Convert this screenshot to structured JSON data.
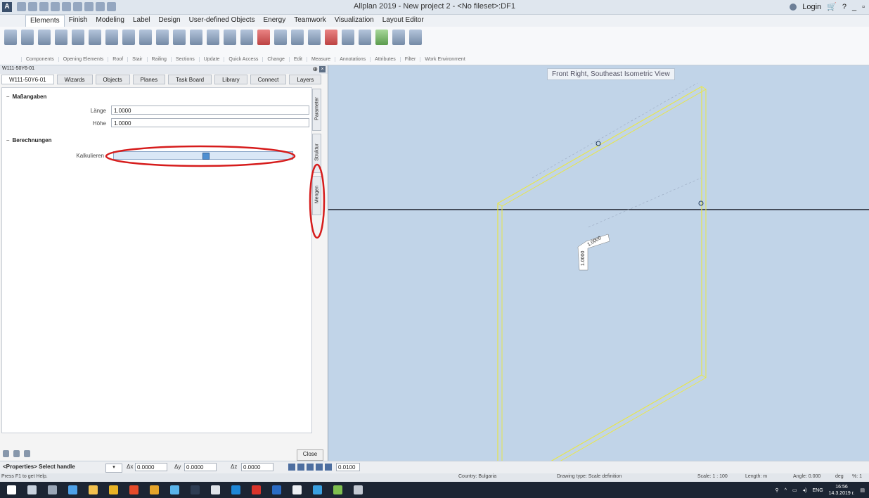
{
  "titlebar": {
    "title": "Allplan 2019 - New project 2 - <No fileset>:DF1",
    "login": "Login"
  },
  "menu_tabs": [
    "Elements",
    "Finish",
    "Modeling",
    "Label",
    "Design",
    "User-defined Objects",
    "Energy",
    "Teamwork",
    "Visualization",
    "Layout Editor"
  ],
  "ribbon_groups": [
    "Components",
    "Opening Elements",
    "Roof",
    "Stair",
    "Railing",
    "Sections",
    "Update",
    "Quick Access",
    "Change",
    "Edit",
    "Measure",
    "Annotations",
    "Attributes",
    "Filter",
    "Work Environment"
  ],
  "panel": {
    "header": "W111-50Y6-01",
    "tabs": [
      "W111-50Y6-01",
      "Wizards",
      "Objects",
      "Planes",
      "Task Board",
      "Library",
      "Connect",
      "Layers"
    ],
    "active_tab": "W111-50Y6-01",
    "section1": "Maßangaben",
    "length_label": "Länge",
    "length_value": "1.0000",
    "height_label": "Höhe",
    "height_value": "1.0000",
    "section2": "Berechnungen",
    "calc_label": "Kalkulieren",
    "side_tabs": [
      "Parameter",
      "Struktur",
      "Mengen"
    ],
    "close_label": "Close"
  },
  "viewport": {
    "view_label": "Front Right, Southeast Isometric View",
    "dim_text_1": "1.0000",
    "dim_text_2": "1.0000"
  },
  "statusbar": {
    "prompt": "<Properties> Select handle",
    "dx_label": "Δx",
    "dx_value": "0.0000",
    "dy_label": "Δy",
    "dy_value": "0.0000",
    "dz_label": "Δz",
    "dz_value": "0.0000",
    "step_value": "0.0100"
  },
  "helpbar": {
    "help_text": "Press F1 to get Help.",
    "country": "Country: Bulgaria",
    "drawing_type": "Drawing type: Scale definition",
    "scale": "Scale: 1 : 100",
    "length": "Length: m",
    "angle": "Angle: 0.000",
    "angle_unit": "deg",
    "percent": "%: 1"
  },
  "taskbar": {
    "lang": "ENG",
    "time": "16:56",
    "date": "14.3.2019 г."
  },
  "colors": {
    "viewport_bg": "#c1d4e8",
    "highlight_red": "#d61c1c",
    "wall_yellow": "#e8e64a"
  }
}
